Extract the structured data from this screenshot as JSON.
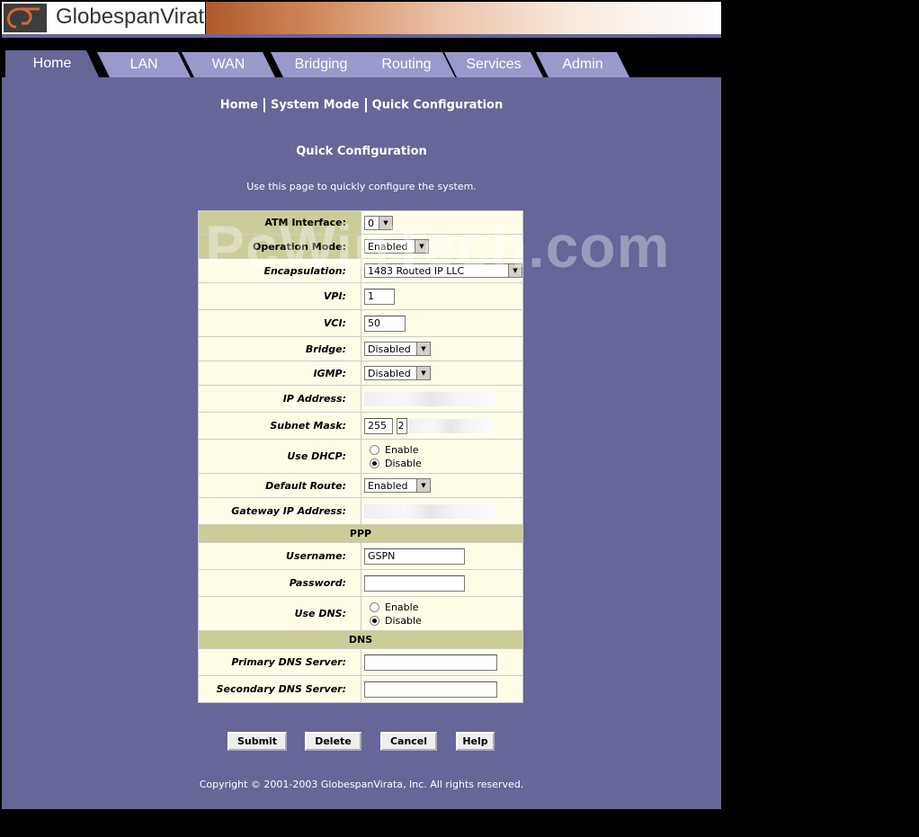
{
  "brand": {
    "name": "GlobespanVirata"
  },
  "tabs": [
    {
      "label": "Home",
      "active": true
    },
    {
      "label": "LAN",
      "active": false
    },
    {
      "label": "WAN",
      "active": false
    },
    {
      "label": "Bridging",
      "active": false
    },
    {
      "label": "Routing",
      "active": false
    },
    {
      "label": "Services",
      "active": false
    },
    {
      "label": "Admin",
      "active": false
    }
  ],
  "breadcrumb": {
    "home": "Home",
    "system_mode": "System Mode",
    "quick_config": "Quick Configuration"
  },
  "page": {
    "title": "Quick Configuration",
    "description": "Use this page to quickly configure the system."
  },
  "form": {
    "atm_interface": {
      "label": "ATM Interface:",
      "value": "0"
    },
    "operation_mode": {
      "label": "Operation Mode:",
      "value": "Enabled"
    },
    "encapsulation": {
      "label": "Encapsulation:",
      "value": "1483 Routed IP LLC"
    },
    "vpi": {
      "label": "VPI:",
      "value": "1"
    },
    "vci": {
      "label": "VCI:",
      "value": "50"
    },
    "bridge": {
      "label": "Bridge:",
      "value": "Disabled"
    },
    "igmp": {
      "label": "IGMP:",
      "value": "Disabled"
    },
    "ip_address": {
      "label": "IP Address:",
      "value": ""
    },
    "subnet_mask": {
      "label": "Subnet Mask:",
      "value1": "255",
      "value2": "2"
    },
    "use_dhcp": {
      "label": "Use DHCP:",
      "opt1": "Enable",
      "opt2": "Disable",
      "selected": "Disable"
    },
    "default_route": {
      "label": "Default Route:",
      "value": "Enabled"
    },
    "gateway_ip": {
      "label": "Gateway IP Address:",
      "value": ""
    },
    "ppp_header": "PPP",
    "username": {
      "label": "Username:",
      "value": "GSPN"
    },
    "password": {
      "label": "Password:",
      "value": ""
    },
    "use_dns": {
      "label": "Use DNS:",
      "opt1": "Enable",
      "opt2": "Disable",
      "selected": "Disable"
    },
    "dns_header": "DNS",
    "primary_dns": {
      "label": "Primary DNS Server:",
      "value": ""
    },
    "secondary_dns": {
      "label": "Secondary DNS Server:",
      "value": ""
    }
  },
  "buttons": {
    "submit": "Submit",
    "delete": "Delete",
    "cancel": "Cancel",
    "help": "Help"
  },
  "copyright": "Copyright © 2001-2003 GlobespanVirata, Inc. All rights reserved.",
  "watermark": "PcWinTech.com"
}
